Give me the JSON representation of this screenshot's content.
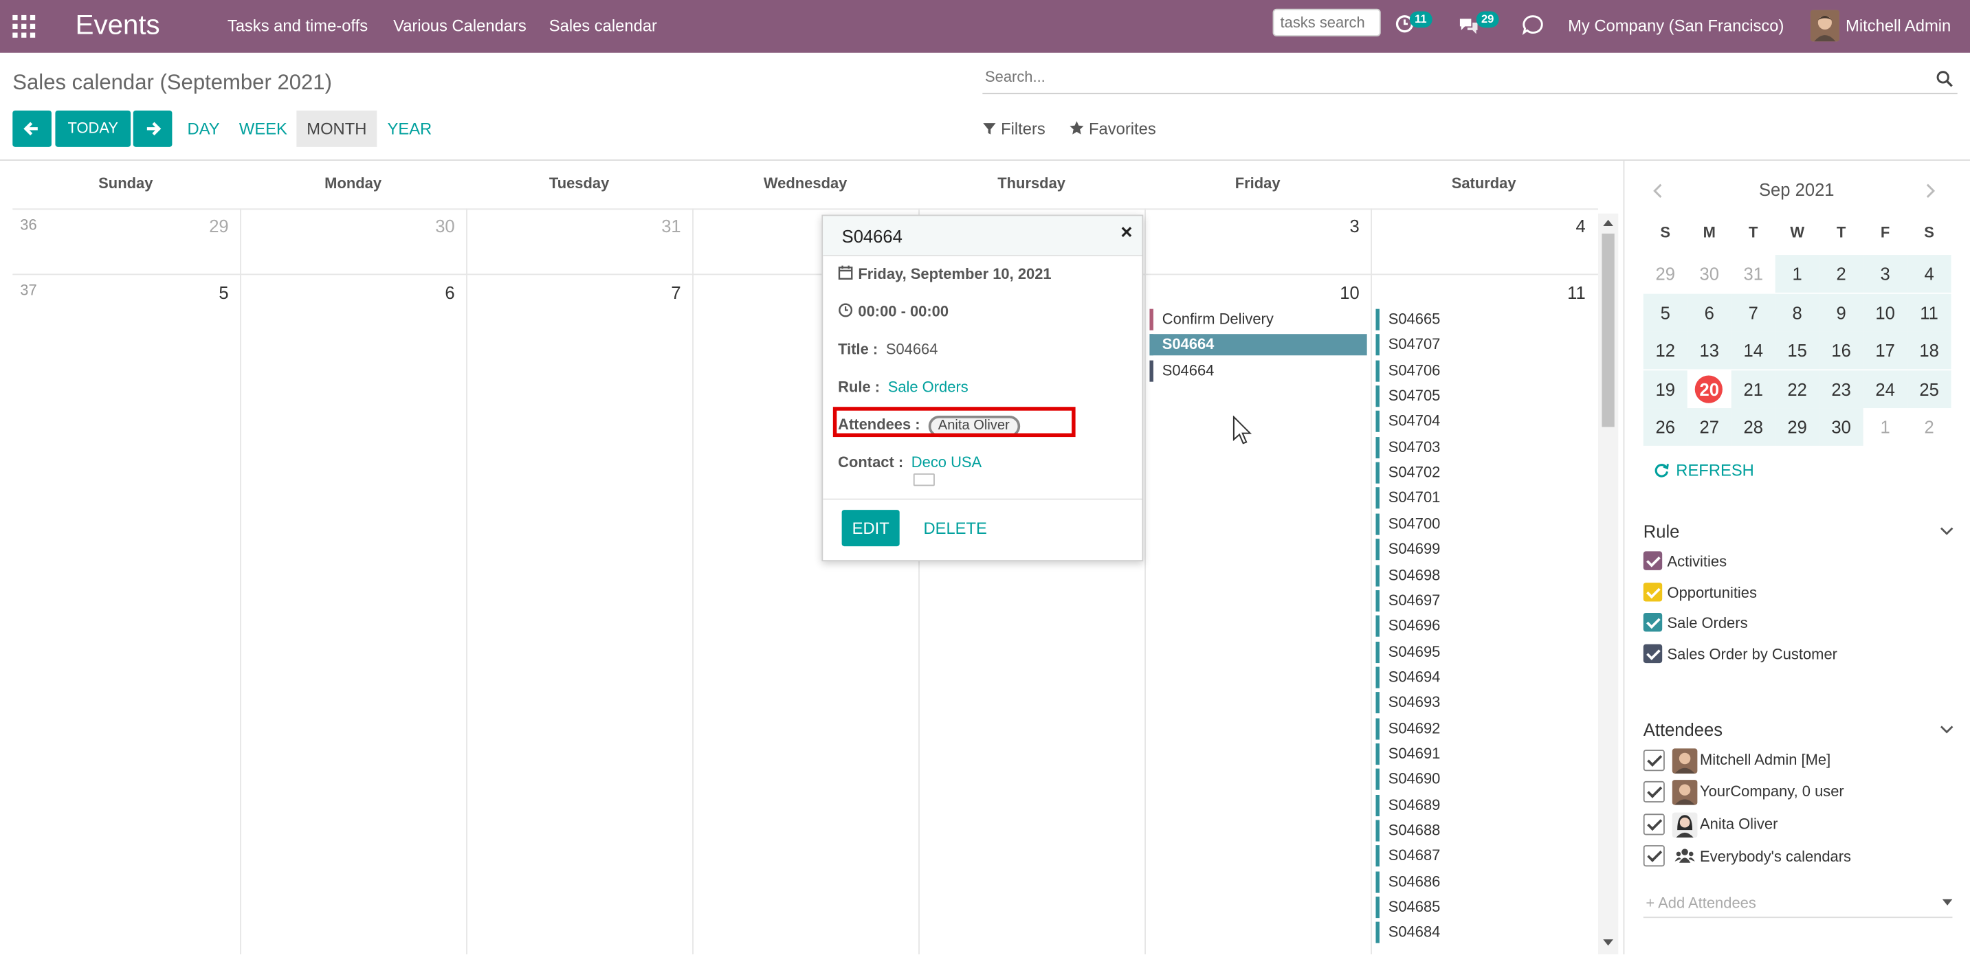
{
  "navbar": {
    "app_title": "Events",
    "menus": [
      "Tasks and time-offs",
      "Various Calendars",
      "Sales calendar"
    ],
    "tasks_search_placeholder": "tasks search",
    "activity_count": "11",
    "message_count": "29",
    "company": "My Company (San Francisco)",
    "user": "Mitchell Admin"
  },
  "control_panel": {
    "title": "Sales calendar (September 2021)",
    "today_label": "TODAY",
    "scales": [
      "DAY",
      "WEEK",
      "MONTH",
      "YEAR"
    ],
    "active_scale": "MONTH",
    "search_placeholder": "Search...",
    "filters_label": "Filters",
    "favorites_label": "Favorites"
  },
  "calendar": {
    "day_headers": [
      "Sunday",
      "Monday",
      "Tuesday",
      "Wednesday",
      "Thursday",
      "Friday",
      "Saturday"
    ],
    "weeks": [
      {
        "week": "36",
        "days": [
          "29",
          "30",
          "31",
          "",
          "",
          "3",
          "4"
        ]
      },
      {
        "week": "37",
        "days": [
          "5",
          "6",
          "7",
          "",
          "",
          "10",
          "11"
        ]
      }
    ],
    "friday_events": [
      "Confirm Delivery",
      "S04664",
      "S04664"
    ],
    "saturday_events": [
      "S04665",
      "S04707",
      "S04706",
      "S04705",
      "S04704",
      "S04703",
      "S04702",
      "S04701",
      "S04700",
      "S04699",
      "S04698",
      "S04697",
      "S04696",
      "S04695",
      "S04694",
      "S04693",
      "S04692",
      "S04691",
      "S04690",
      "S04689",
      "S04688",
      "S04687",
      "S04686",
      "S04685",
      "S04684"
    ]
  },
  "popover": {
    "title": "S04664",
    "date": "Friday, September 10, 2021",
    "time": "00:00 - 00:00",
    "title_label": "Title :",
    "title_value": "S04664",
    "rule_label": "Rule :",
    "rule_value": "Sale Orders",
    "attendees_label": "Attendees :",
    "attendee": "Anita Oliver",
    "contact_label": "Contact :",
    "contact_value": "Deco USA",
    "edit_label": "EDIT",
    "delete_label": "DELETE",
    "close_label": "×"
  },
  "mini_calendar": {
    "month": "Sep 2021",
    "weekdays": [
      "S",
      "M",
      "T",
      "W",
      "T",
      "F",
      "S"
    ],
    "rows": [
      [
        "29",
        "30",
        "31",
        "1",
        "2",
        "3",
        "4"
      ],
      [
        "5",
        "6",
        "7",
        "8",
        "9",
        "10",
        "11"
      ],
      [
        "12",
        "13",
        "14",
        "15",
        "16",
        "17",
        "18"
      ],
      [
        "19",
        "20",
        "21",
        "22",
        "23",
        "24",
        "25"
      ],
      [
        "26",
        "27",
        "28",
        "29",
        "30",
        "1",
        "2"
      ]
    ],
    "today": "20",
    "refresh_label": "REFRESH"
  },
  "rule_filter": {
    "heading": "Rule",
    "items": [
      {
        "label": "Activities",
        "color": "#875a7b"
      },
      {
        "label": "Opportunities",
        "color": "#f0c419"
      },
      {
        "label": "Sale Orders",
        "color": "#31929b"
      },
      {
        "label": "Sales Order by Customer",
        "color": "#4a5368"
      }
    ]
  },
  "attendees_filter": {
    "heading": "Attendees",
    "items": [
      "Mitchell Admin [Me]",
      "YourCompany, 0 user",
      "Anita Oliver",
      "Everybody's calendars"
    ],
    "add_placeholder": "+ Add Attendees"
  },
  "colors": {
    "brand": "#875a7b",
    "accent": "#00a09d",
    "highlight": "#e00000"
  }
}
